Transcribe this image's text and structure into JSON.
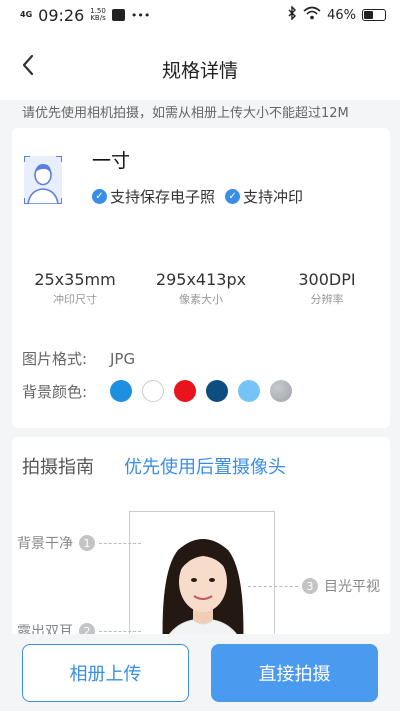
{
  "status_bar": {
    "signal": "4G",
    "time": "09:26",
    "speed_value": "1.50",
    "speed_unit": "KB/s",
    "more": "•••",
    "battery": "46%",
    "battery_level": 0.46
  },
  "nav": {
    "title": "规格详情",
    "back_icon": "chevron-left-icon"
  },
  "notice": "请优先使用相机拍摄，如需从相册上传大小不能超过12M",
  "spec": {
    "name": "一寸",
    "tags": [
      "支持保存电子照",
      "支持冲印"
    ],
    "stats": [
      {
        "value": "25x35mm",
        "label": "冲印尺寸"
      },
      {
        "value": "295x413px",
        "label": "像素大小"
      },
      {
        "value": "300DPI",
        "label": "分辨率"
      }
    ],
    "format_label": "图片格式:",
    "format_value": "JPG",
    "bg_label": "背景颜色:",
    "bg_colors": [
      "#1e8fe1",
      "#ffffff",
      "#e8131b",
      "#0e4d80",
      "#76c4f5",
      "#9ea2a8"
    ]
  },
  "guide": {
    "title": "拍摄指南",
    "hint": "优先使用后置摄像头",
    "callouts": [
      {
        "num": "1",
        "text": "背景干净"
      },
      {
        "num": "2",
        "text": "露出双耳"
      },
      {
        "num": "3",
        "text": "目光平视"
      }
    ]
  },
  "buttons": {
    "album": "相册上传",
    "shoot": "直接拍摄"
  }
}
